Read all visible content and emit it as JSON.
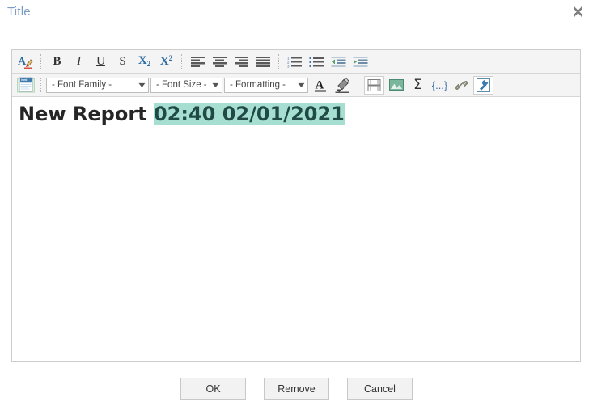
{
  "dialog": {
    "title": "Title",
    "close_icon": "close-icon"
  },
  "toolbar": {
    "row1": [
      {
        "name": "font-color-picker",
        "icon": "a-with-pen-icon",
        "label": "A"
      },
      {
        "name": "bold-button",
        "icon": "bold-icon",
        "label": "B"
      },
      {
        "name": "italic-button",
        "icon": "italic-icon",
        "label": "I"
      },
      {
        "name": "underline-button",
        "icon": "underline-icon",
        "label": "U"
      },
      {
        "name": "strikethrough-button",
        "icon": "strikethrough-icon",
        "label": "S"
      },
      {
        "name": "subscript-button",
        "icon": "subscript-icon",
        "label": "X",
        "script": "2"
      },
      {
        "name": "superscript-button",
        "icon": "superscript-icon",
        "label": "X",
        "script": "2"
      },
      {
        "name": "align-left-button",
        "icon": "align-left-icon"
      },
      {
        "name": "align-center-button",
        "icon": "align-center-icon"
      },
      {
        "name": "align-right-button",
        "icon": "align-right-icon"
      },
      {
        "name": "align-justify-button",
        "icon": "align-justify-icon"
      },
      {
        "name": "numbered-list-button",
        "icon": "ordered-list-icon"
      },
      {
        "name": "bullet-list-button",
        "icon": "unordered-list-icon"
      },
      {
        "name": "outdent-button",
        "icon": "outdent-icon"
      },
      {
        "name": "indent-button",
        "icon": "indent-icon"
      }
    ],
    "row2": {
      "source_button": {
        "name": "view-html-source-button",
        "icon": "html-document-icon",
        "label": "html"
      },
      "font_family": {
        "value": "- Font Family -",
        "chevron": "▼"
      },
      "font_size": {
        "value": "- Font Size -",
        "chevron": "▼"
      },
      "formatting": {
        "value": "- Formatting -",
        "chevron": "▼"
      },
      "buttons": [
        {
          "name": "text-color-button",
          "icon": "underlined-a-icon",
          "label": "A"
        },
        {
          "name": "highlight-color-button",
          "icon": "highlighter-pen-icon"
        },
        {
          "name": "insert-table-button",
          "icon": "table-icon"
        },
        {
          "name": "insert-image-button",
          "icon": "image-icon"
        },
        {
          "name": "insert-formula-button",
          "icon": "sigma-icon",
          "label": "Σ"
        },
        {
          "name": "insert-placeholder-button",
          "icon": "curly-braces-icon",
          "label": "{...}"
        },
        {
          "name": "insert-link-button",
          "icon": "link-chain-icon"
        },
        {
          "name": "tools-button",
          "icon": "wrench-icon"
        }
      ]
    }
  },
  "content": {
    "text_plain": "New Report ",
    "text_selected": "02:40 02/01/2021"
  },
  "footer": {
    "ok": "OK",
    "remove": "Remove",
    "cancel": "Cancel"
  },
  "colors": {
    "title": "#7b9cc4",
    "selection_highlight": "#a7ded2",
    "toolbar_bg": "#f4f4f4",
    "accent_blue": "#2e6da4"
  }
}
